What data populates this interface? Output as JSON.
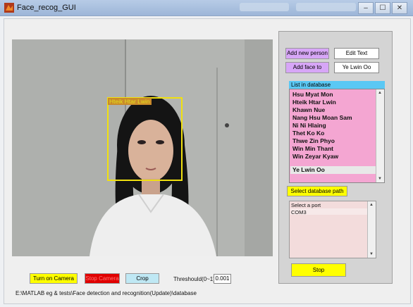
{
  "window": {
    "title": "Face_recog_GUI",
    "controls": [
      "–",
      "☐",
      "✕"
    ]
  },
  "camera": {
    "face_label": "Hteik Htar Lwin"
  },
  "bottom": {
    "turn_on_label": "Turn on Camera",
    "stop_camera_label": "Stop Camera",
    "crop_label": "Crop",
    "threshold_label": "Threshould(0~1)",
    "threshold_value": "0.001",
    "path": "E:\\MATLAB eg & tests\\Face detection and recognition(Update)\\database"
  },
  "side": {
    "add_person_label": "Add new person",
    "edit_text_value": "Edit Text",
    "add_face_label": "Add face to",
    "name_value": "Ye Lwin Oo",
    "list_heading": "List in database",
    "people": [
      "Hsu Myat Mon",
      "Hteik Htar Lwin",
      "Khawn Nue",
      "Nang Hsu Moan Sam",
      "Ni Ni Hlaing",
      "Thet Ko Ko",
      "Thwe Zin Phyo",
      "Win Min Thant",
      "Win Zeyar Kyaw",
      "Ye Lwin Oo"
    ],
    "select_db_label": "Select database path",
    "port_prompt": "Select a port",
    "port_value": "COM3",
    "stop_label": "Stop"
  },
  "colors": {
    "yellow_button": "#ffff00",
    "red_button": "#e00000",
    "list_pink": "#f4a6d2",
    "list_heading_blue": "#5ac8f4",
    "violet_button": "#d7a6f7",
    "face_box": "#f0e010"
  }
}
